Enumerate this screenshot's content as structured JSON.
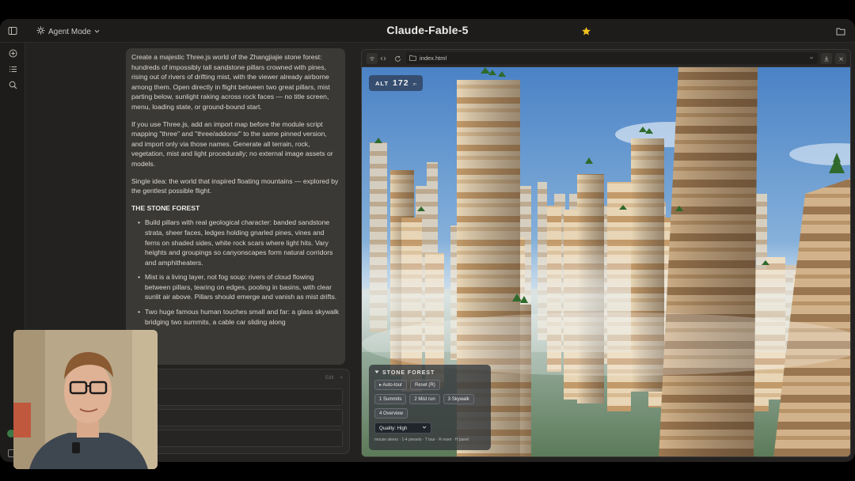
{
  "app": {
    "title": "Claude-Fable-5",
    "mode_label": "Agent Mode"
  },
  "chat": {
    "prompt_paragraphs": [
      "Create a majestic Three.js world of the Zhangjiajie stone forest: hundreds of impossibly tall sandstone pillars crowned with pines, rising out of rivers of drifting mist, with the viewer already airborne among them. Open directly in flight between two great pillars, mist parting below, sunlight raking across rock faces — no title screen, menu, loading state, or ground-bound start.",
      "If you use Three.js, add an import map before the module script mapping \"three\" and \"three/addons/\" to the same pinned version, and import only via those names. Generate all terrain, rock, vegetation, mist and light procedurally; no external image assets or models.",
      "Single idea: the world that inspired floating mountains — explored by the gentlest possible flight."
    ],
    "section_heading": "THE STONE FOREST",
    "bullets": [
      "Build pillars with real geological character: banded sandstone strata, sheer faces, ledges holding gnarled pines, vines and ferns on shaded sides, white rock scars where light hits. Vary heights and groupings so canyonscapes form natural corridors and amphitheaters.",
      "Mist is a living layer, not fog soup: rivers of cloud flowing between pillars, tearing on edges, pooling in basins, with clear sunlit air above. Pillars should emerge and vanish as mist drifts.",
      "Two huge famous human touches small and far: a glass skywalk bridging two summits, a cable car sliding along"
    ],
    "input_header_labels": [
      "Edit",
      "×"
    ]
  },
  "preview": {
    "url": "index.html",
    "altitude_label": "ALT",
    "altitude_value": "172",
    "altitude_unit": "m",
    "panel": {
      "title": "STONE FOREST",
      "buttons_row1": [
        "▸ Auto-tour",
        "Reset (R)"
      ],
      "buttons_row2": [
        "1 Summits",
        "2 Mist run",
        "3 Skywalk"
      ],
      "buttons_row3": [
        "4 Overview"
      ],
      "quality_label": "Quality: High",
      "hint": "mouse steers · 1-4 presets · T tour · R reset · H panel"
    }
  },
  "icons": {
    "sidebar_toggle": "sidebar-toggle-icon",
    "new_chat": "plus-circle-icon",
    "list": "list-icon",
    "search": "search-icon",
    "favorite": "star-icon",
    "folder": "folder-icon"
  },
  "colors": {
    "accent_star": "#f0c020",
    "sky_top": "#4f86c8",
    "sky_bottom": "#c7dcec"
  }
}
